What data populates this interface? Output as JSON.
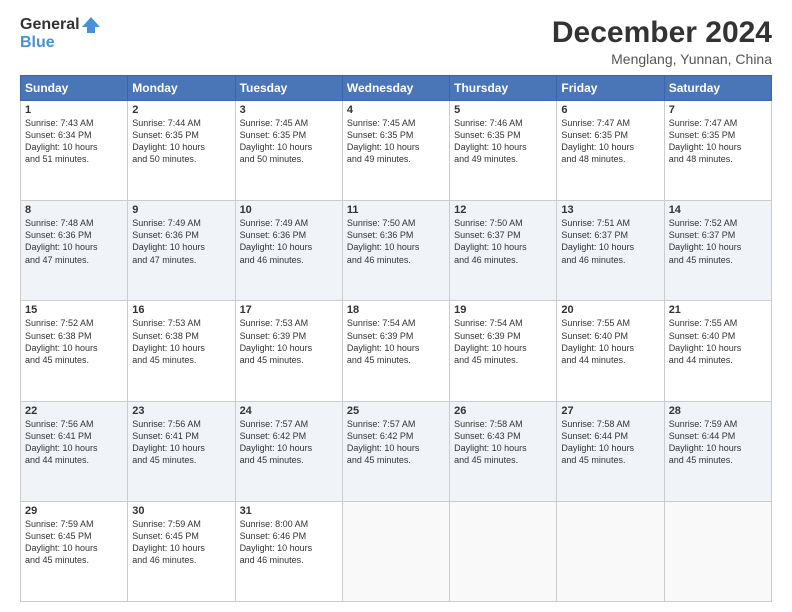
{
  "header": {
    "logo_general": "General",
    "logo_blue": "Blue",
    "title": "December 2024",
    "location": "Menglang, Yunnan, China"
  },
  "days_of_week": [
    "Sunday",
    "Monday",
    "Tuesday",
    "Wednesday",
    "Thursday",
    "Friday",
    "Saturday"
  ],
  "weeks": [
    [
      {
        "day": "1",
        "info": "Sunrise: 7:43 AM\nSunset: 6:34 PM\nDaylight: 10 hours\nand 51 minutes."
      },
      {
        "day": "2",
        "info": "Sunrise: 7:44 AM\nSunset: 6:35 PM\nDaylight: 10 hours\nand 50 minutes."
      },
      {
        "day": "3",
        "info": "Sunrise: 7:45 AM\nSunset: 6:35 PM\nDaylight: 10 hours\nand 50 minutes."
      },
      {
        "day": "4",
        "info": "Sunrise: 7:45 AM\nSunset: 6:35 PM\nDaylight: 10 hours\nand 49 minutes."
      },
      {
        "day": "5",
        "info": "Sunrise: 7:46 AM\nSunset: 6:35 PM\nDaylight: 10 hours\nand 49 minutes."
      },
      {
        "day": "6",
        "info": "Sunrise: 7:47 AM\nSunset: 6:35 PM\nDaylight: 10 hours\nand 48 minutes."
      },
      {
        "day": "7",
        "info": "Sunrise: 7:47 AM\nSunset: 6:35 PM\nDaylight: 10 hours\nand 48 minutes."
      }
    ],
    [
      {
        "day": "8",
        "info": "Sunrise: 7:48 AM\nSunset: 6:36 PM\nDaylight: 10 hours\nand 47 minutes."
      },
      {
        "day": "9",
        "info": "Sunrise: 7:49 AM\nSunset: 6:36 PM\nDaylight: 10 hours\nand 47 minutes."
      },
      {
        "day": "10",
        "info": "Sunrise: 7:49 AM\nSunset: 6:36 PM\nDaylight: 10 hours\nand 46 minutes."
      },
      {
        "day": "11",
        "info": "Sunrise: 7:50 AM\nSunset: 6:36 PM\nDaylight: 10 hours\nand 46 minutes."
      },
      {
        "day": "12",
        "info": "Sunrise: 7:50 AM\nSunset: 6:37 PM\nDaylight: 10 hours\nand 46 minutes."
      },
      {
        "day": "13",
        "info": "Sunrise: 7:51 AM\nSunset: 6:37 PM\nDaylight: 10 hours\nand 46 minutes."
      },
      {
        "day": "14",
        "info": "Sunrise: 7:52 AM\nSunset: 6:37 PM\nDaylight: 10 hours\nand 45 minutes."
      }
    ],
    [
      {
        "day": "15",
        "info": "Sunrise: 7:52 AM\nSunset: 6:38 PM\nDaylight: 10 hours\nand 45 minutes."
      },
      {
        "day": "16",
        "info": "Sunrise: 7:53 AM\nSunset: 6:38 PM\nDaylight: 10 hours\nand 45 minutes."
      },
      {
        "day": "17",
        "info": "Sunrise: 7:53 AM\nSunset: 6:39 PM\nDaylight: 10 hours\nand 45 minutes."
      },
      {
        "day": "18",
        "info": "Sunrise: 7:54 AM\nSunset: 6:39 PM\nDaylight: 10 hours\nand 45 minutes."
      },
      {
        "day": "19",
        "info": "Sunrise: 7:54 AM\nSunset: 6:39 PM\nDaylight: 10 hours\nand 45 minutes."
      },
      {
        "day": "20",
        "info": "Sunrise: 7:55 AM\nSunset: 6:40 PM\nDaylight: 10 hours\nand 44 minutes."
      },
      {
        "day": "21",
        "info": "Sunrise: 7:55 AM\nSunset: 6:40 PM\nDaylight: 10 hours\nand 44 minutes."
      }
    ],
    [
      {
        "day": "22",
        "info": "Sunrise: 7:56 AM\nSunset: 6:41 PM\nDaylight: 10 hours\nand 44 minutes."
      },
      {
        "day": "23",
        "info": "Sunrise: 7:56 AM\nSunset: 6:41 PM\nDaylight: 10 hours\nand 45 minutes."
      },
      {
        "day": "24",
        "info": "Sunrise: 7:57 AM\nSunset: 6:42 PM\nDaylight: 10 hours\nand 45 minutes."
      },
      {
        "day": "25",
        "info": "Sunrise: 7:57 AM\nSunset: 6:42 PM\nDaylight: 10 hours\nand 45 minutes."
      },
      {
        "day": "26",
        "info": "Sunrise: 7:58 AM\nSunset: 6:43 PM\nDaylight: 10 hours\nand 45 minutes."
      },
      {
        "day": "27",
        "info": "Sunrise: 7:58 AM\nSunset: 6:44 PM\nDaylight: 10 hours\nand 45 minutes."
      },
      {
        "day": "28",
        "info": "Sunrise: 7:59 AM\nSunset: 6:44 PM\nDaylight: 10 hours\nand 45 minutes."
      }
    ],
    [
      {
        "day": "29",
        "info": "Sunrise: 7:59 AM\nSunset: 6:45 PM\nDaylight: 10 hours\nand 45 minutes."
      },
      {
        "day": "30",
        "info": "Sunrise: 7:59 AM\nSunset: 6:45 PM\nDaylight: 10 hours\nand 46 minutes."
      },
      {
        "day": "31",
        "info": "Sunrise: 8:00 AM\nSunset: 6:46 PM\nDaylight: 10 hours\nand 46 minutes."
      },
      {
        "day": "",
        "info": ""
      },
      {
        "day": "",
        "info": ""
      },
      {
        "day": "",
        "info": ""
      },
      {
        "day": "",
        "info": ""
      }
    ]
  ]
}
